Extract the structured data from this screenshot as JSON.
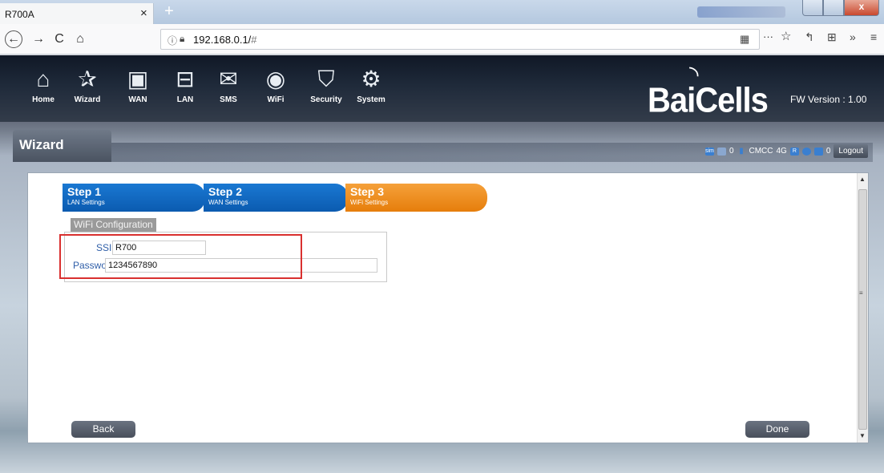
{
  "browser": {
    "tab_title": "R700A",
    "tab_close": "×",
    "new_tab": "+",
    "close_glyph": "x",
    "url_info_icon": "ⓘ",
    "url_host": "192.168.0.1/",
    "url_path": "#",
    "back_icon": "←",
    "forward_icon": "→",
    "reload_icon": "C",
    "home_icon": "⌂",
    "more_icon": "···",
    "star_icon": "☆",
    "toolbar_icons": [
      "↰",
      "⊞",
      "»",
      "≡"
    ]
  },
  "nav": {
    "items": [
      {
        "label": "Home",
        "icon": "home-icon",
        "glyph": "⌂"
      },
      {
        "label": "Wizard",
        "icon": "wizard-icon",
        "glyph": "✰"
      },
      {
        "label": "WAN",
        "icon": "wan-icon",
        "glyph": "▣"
      },
      {
        "label": "LAN",
        "icon": "lan-icon",
        "glyph": "⊟"
      },
      {
        "label": "SMS",
        "icon": "sms-icon",
        "glyph": "✉"
      },
      {
        "label": "WiFi",
        "icon": "wifi-icon",
        "glyph": "◉"
      },
      {
        "label": "Security",
        "icon": "security-icon",
        "glyph": "⛉"
      },
      {
        "label": "System",
        "icon": "system-icon",
        "glyph": "⚙"
      }
    ],
    "logo_text": "BaiCells",
    "fw_version": "FW Version : 1.00"
  },
  "section": {
    "title": "Wizard"
  },
  "status": {
    "sim": "sim",
    "sms_count": "0",
    "operator": "CMCC",
    "network": "4G",
    "roaming": "R",
    "messages_count": "0",
    "logout": "Logout"
  },
  "steps": [
    {
      "title": "Step 1",
      "subtitle": "LAN Settings",
      "state": "done"
    },
    {
      "title": "Step 2",
      "subtitle": "WAN Settings",
      "state": "done"
    },
    {
      "title": "Step 3",
      "subtitle": "WiFi Settings",
      "state": "active"
    }
  ],
  "wifi_config": {
    "section_label": "WiFi Configuration",
    "ssid_label": "SSID",
    "ssid_value": "R700",
    "password_label": "Password",
    "password_value": "1234567890"
  },
  "buttons": {
    "back": "Back",
    "done": "Done"
  },
  "colors": {
    "step_blue": "#0b5bb0",
    "step_orange": "#e67e0b",
    "highlight_red": "#d9302f",
    "label_blue": "#2f5ea8"
  }
}
